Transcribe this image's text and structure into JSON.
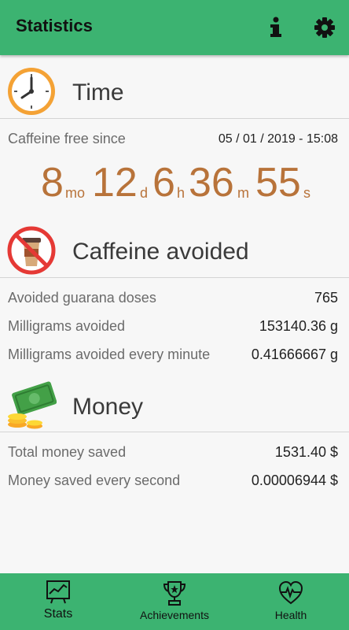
{
  "appbar": {
    "title": "Statistics",
    "info_icon": "info-icon",
    "settings_icon": "gear-icon"
  },
  "time": {
    "title": "Time",
    "since_label": "Caffeine free since",
    "since_value": "05 / 01 / 2019 - 15:08",
    "timer": {
      "months": "8",
      "months_unit": "mo",
      "days": "12",
      "days_unit": "d",
      "hours": "6",
      "hours_unit": "h",
      "minutes": "36",
      "minutes_unit": "m",
      "seconds": "55",
      "seconds_unit": "s"
    }
  },
  "caffeine": {
    "title": "Caffeine avoided",
    "rows": [
      {
        "label": "Avoided guarana doses",
        "value": "765"
      },
      {
        "label": "Milligrams avoided",
        "value": "153140.36 g"
      },
      {
        "label": "Milligrams avoided every minute",
        "value": "0.41666667 g"
      }
    ]
  },
  "money": {
    "title": "Money",
    "rows": [
      {
        "label": "Total money saved",
        "value": "1531.40 $"
      },
      {
        "label": "Money saved every second",
        "value": "0.00006944 $"
      }
    ]
  },
  "nav": [
    {
      "label": "Stats",
      "icon": "stats-chart-icon"
    },
    {
      "label": "Achievements",
      "icon": "trophy-icon"
    },
    {
      "label": "Health",
      "icon": "heart-pulse-icon"
    }
  ],
  "colors": {
    "accent": "#3cb371",
    "timer": "#b8733a"
  }
}
